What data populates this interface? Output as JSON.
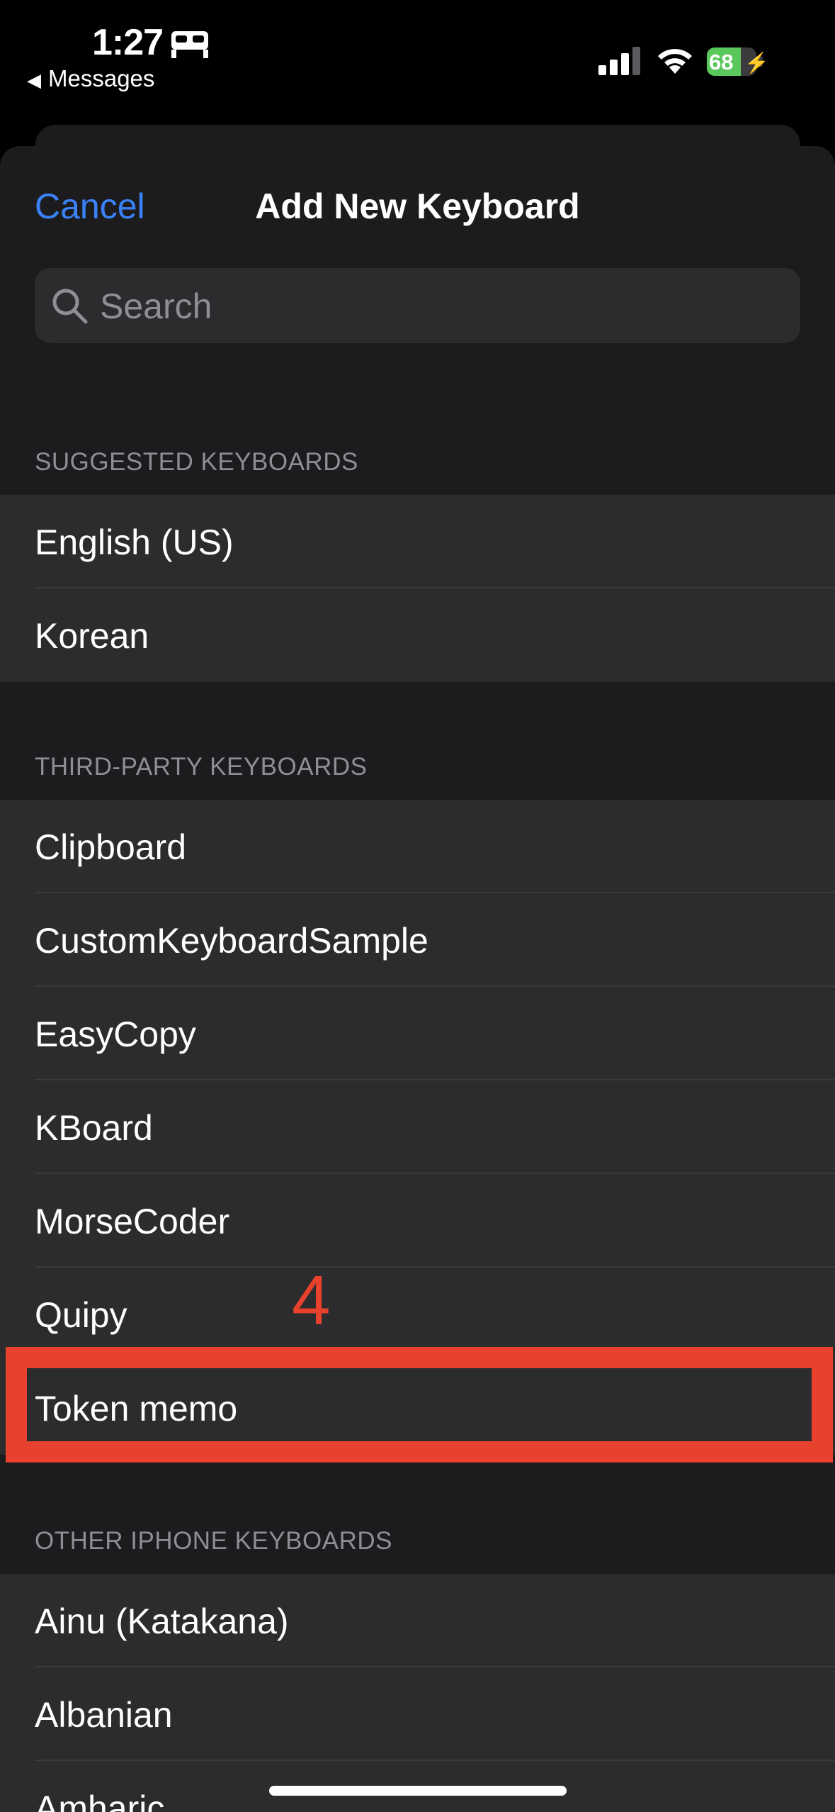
{
  "status_bar": {
    "time": "1:27",
    "back_app": "Messages",
    "battery_percent": "68",
    "battery_level": 0.68
  },
  "sheet": {
    "cancel_label": "Cancel",
    "title": "Add New Keyboard",
    "search_placeholder": "Search"
  },
  "sections": {
    "suggested": {
      "header": "SUGGESTED KEYBOARDS",
      "items": [
        "English (US)",
        "Korean"
      ]
    },
    "third_party": {
      "header": "THIRD-PARTY KEYBOARDS",
      "items": [
        "Clipboard",
        "CustomKeyboardSample",
        "EasyCopy",
        "KBoard",
        "MorseCoder",
        "Quipy",
        "Token memo"
      ]
    },
    "other": {
      "header": "OTHER IPHONE KEYBOARDS",
      "items": [
        "Ainu (Katakana)",
        "Albanian",
        "Amharic"
      ]
    }
  },
  "annotation": {
    "step_number": "4",
    "color": "#e8412d"
  },
  "colors": {
    "accent": "#3a82f7",
    "sheet_background": "#1c1c1e",
    "row_background": "#2c2c2e"
  }
}
